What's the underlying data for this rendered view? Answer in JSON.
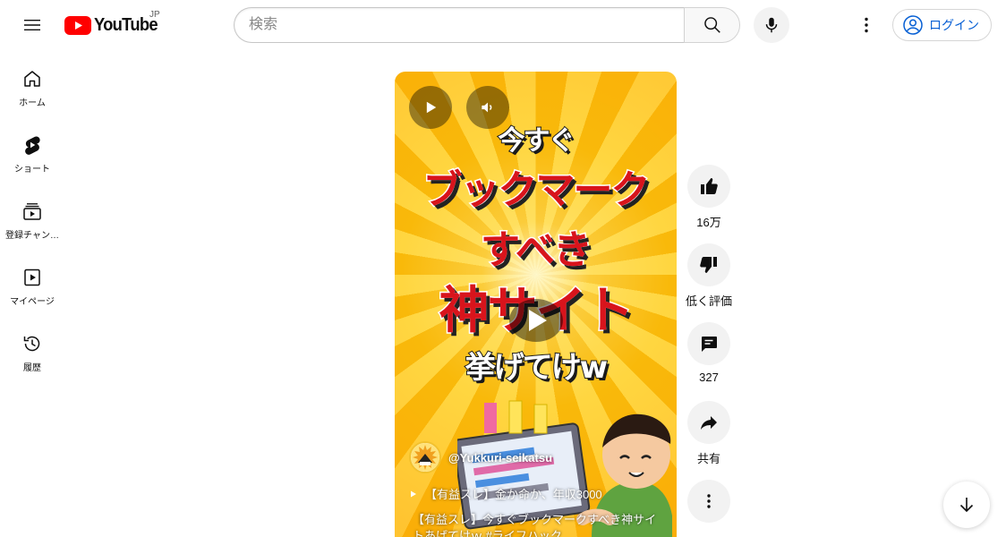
{
  "header": {
    "logo_text": "YouTube",
    "region": "JP",
    "search_placeholder": "検索",
    "login_label": "ログイン"
  },
  "sidebar": {
    "items": [
      {
        "label": "ホーム",
        "icon": "home-icon"
      },
      {
        "label": "ショート",
        "icon": "shorts-icon"
      },
      {
        "label": "登録チャン…",
        "icon": "subscriptions-icon"
      },
      {
        "label": "マイページ",
        "icon": "library-icon"
      },
      {
        "label": "履歴",
        "icon": "history-icon"
      }
    ]
  },
  "video": {
    "thumbnail_lines": [
      "今すぐ",
      "ブックマーク",
      "すべき",
      "神サイト",
      "挙げてけw"
    ],
    "channel": "@Yukkuri-seikatsu",
    "playlist": "【有益スレ】金か命か、年収3000",
    "title": "【有益スレ】今すぐブックマークすべき神サイトあげてけｗ #ライフハック"
  },
  "actions": {
    "like_count": "16万",
    "dislike_label": "低く評価",
    "comment_count": "327",
    "share_label": "共有"
  },
  "colors": {
    "brand_red": "#ff0000",
    "link_blue": "#065fd4",
    "thumbnail_red": "#d8141c",
    "thumbnail_yellow": "#f9b90a"
  }
}
